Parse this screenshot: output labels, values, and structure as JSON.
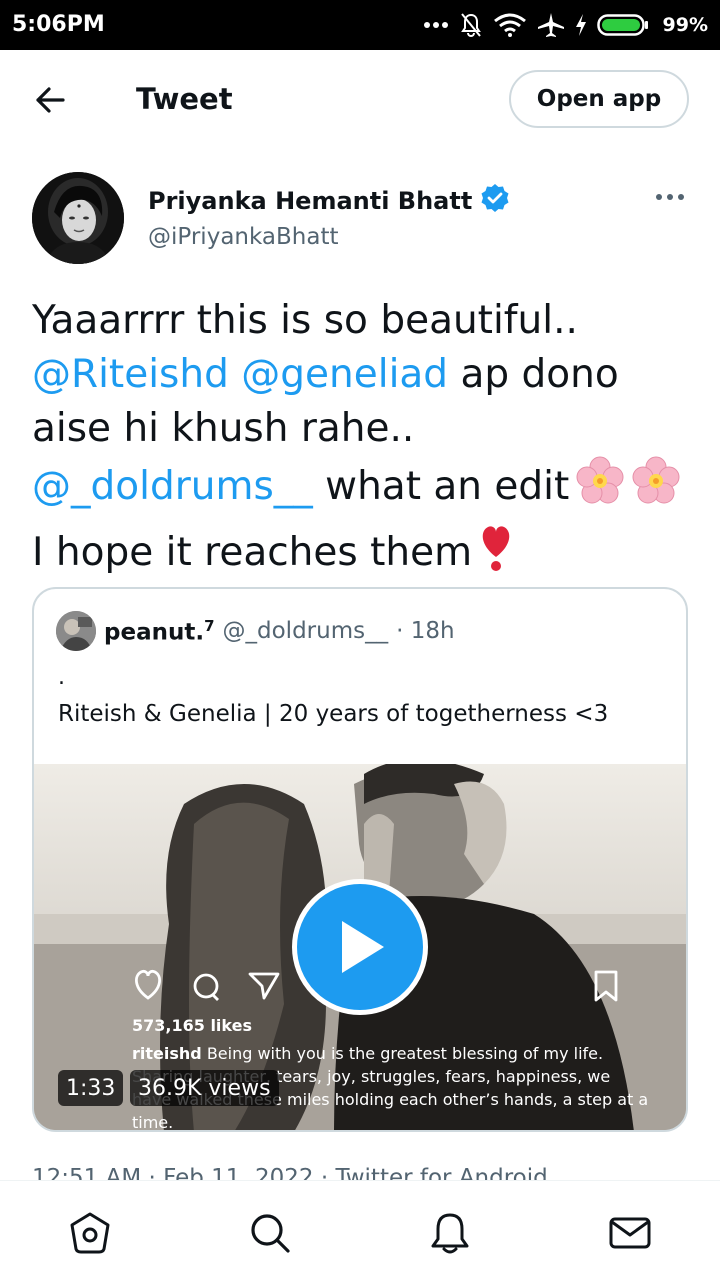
{
  "status_bar": {
    "time": "5:06PM",
    "battery_percent": "99%",
    "icons": [
      "more-dots-icon",
      "mute-icon",
      "wifi-icon",
      "airplane-icon",
      "charging-icon",
      "battery-icon"
    ]
  },
  "header": {
    "title": "Tweet",
    "back_icon": "back-arrow-icon",
    "open_app_label": "Open app"
  },
  "tweet": {
    "author": {
      "name": "Priyanka Hemanti Bhatt",
      "handle": "@iPriyankaBhatt",
      "verified": true
    },
    "text_lines": [
      [
        {
          "t": "Yaaarrrr this is so beautiful..",
          "mention": false
        }
      ],
      [
        {
          "t": "@Riteishd",
          "mention": true
        },
        {
          "t": " ",
          "mention": false
        },
        {
          "t": "@geneliad",
          "mention": true
        },
        {
          "t": " ap dono",
          "mention": false
        }
      ],
      [
        {
          "t": "aise hi khush rahe..",
          "mention": false
        }
      ],
      [
        {
          "t": "@_doldrums__",
          "mention": true
        },
        {
          "t": " what an edit",
          "mention": false
        }
      ],
      [
        {
          "t": "I hope it reaches them",
          "mention": false
        }
      ]
    ],
    "timestamp": "12:51 AM · Feb 11, 2022 · Twitter for Android"
  },
  "quoted_tweet": {
    "name": "peanut.",
    "name_sup": "7",
    "handle": "@_doldrums__",
    "time": "· 18h",
    "dot_line": ".",
    "text": "Riteish & Genelia | 20 years of togetherness <3",
    "video": {
      "duration": "1:33",
      "views": "36.9K views",
      "overlay_likes": "573,165 likes",
      "overlay_user": "riteishd",
      "overlay_caption_1": " Being with you is the greatest blessing of my life.",
      "overlay_caption_2": "Sharing laughter, tears, joy, struggles, fears, happiness, we",
      "overlay_caption_3": "have walked these miles holding each other’s hands, a step at a",
      "overlay_caption_4": "time."
    }
  },
  "bottom_nav": {
    "items": [
      "home-icon",
      "search-icon",
      "notifications-icon",
      "messages-icon"
    ]
  },
  "colors": {
    "accent": "#1d9bf0",
    "text": "#0f1419",
    "secondary": "#536471",
    "border": "#cfd9de",
    "status_bar": "#000000"
  }
}
